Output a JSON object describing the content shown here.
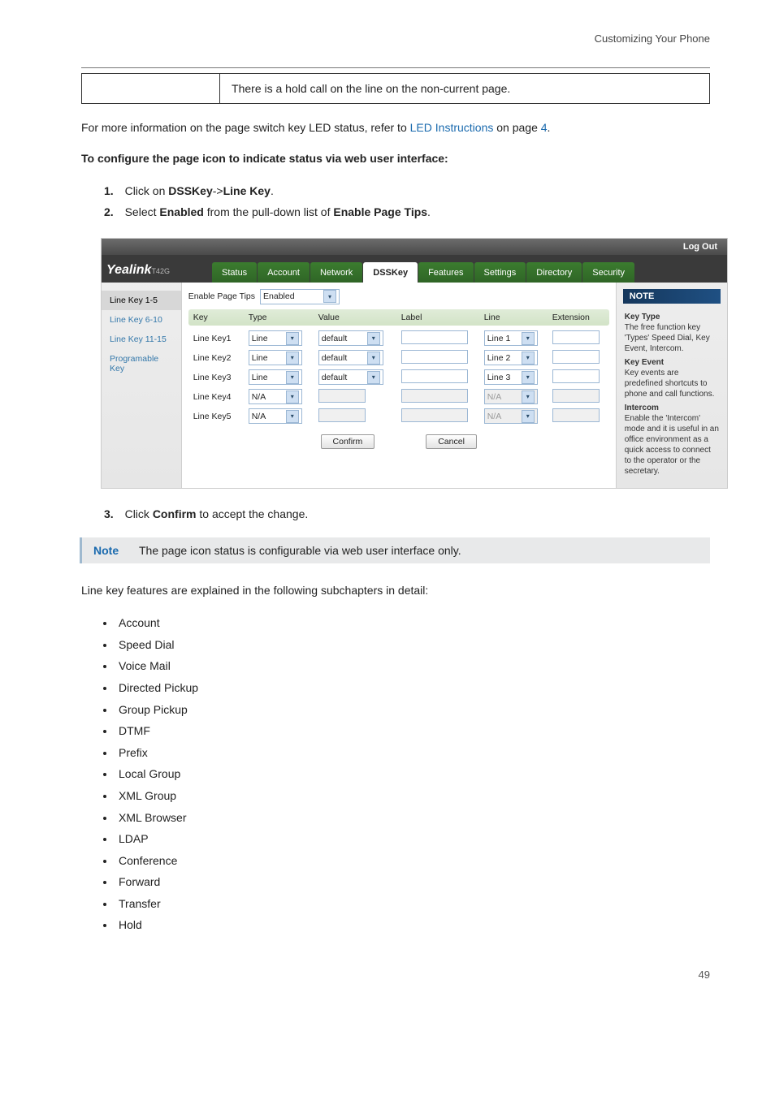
{
  "header": {
    "title": "Customizing Your Phone"
  },
  "infobox": {
    "text": "There is a hold call on the line on the non-current page."
  },
  "intro": {
    "pre": "For more information on the page switch key LED status, refer to ",
    "link": "LED Instructions",
    "post": " on page ",
    "page": "4",
    "period": "."
  },
  "subhead": "To configure the page icon to indicate status via web user interface:",
  "steps": [
    {
      "n": "1.",
      "pre": "Click on ",
      "b1": "DSSKey",
      "mid": "->",
      "b2": "Line Key",
      "post": "."
    },
    {
      "n": "2.",
      "pre": "Select ",
      "b1": "Enabled",
      "mid": " from the pull-down list of ",
      "b2": "Enable Page Tips",
      "post": "."
    }
  ],
  "step3": {
    "n": "3.",
    "pre": "Click ",
    "b1": "Confirm",
    "post": " to accept the change."
  },
  "note": {
    "label": "Note",
    "text": "The page icon status is configurable via web user interface only."
  },
  "subchapters_intro": "Line key features are explained in the following subchapters in detail:",
  "bullets": [
    "Account",
    "Speed Dial",
    "Voice Mail",
    "Directed Pickup",
    "Group Pickup",
    "DTMF",
    "Prefix",
    "Local Group",
    "XML Group",
    "XML Browser",
    "LDAP",
    "Conference",
    "Forward",
    "Transfer",
    "Hold"
  ],
  "pagenum": "49",
  "screenshot": {
    "logout": "Log Out",
    "logo": "Yealink",
    "logo_sub": "T42G",
    "tabs": [
      "Status",
      "Account",
      "Network",
      "DSSKey",
      "Features",
      "Settings",
      "Directory",
      "Security"
    ],
    "active_tab": "DSSKey",
    "side_items": [
      "Line Key 1-5",
      "Line Key 6-10",
      "Line Key 11-15",
      "Programable Key"
    ],
    "side_active": "Line Key 1-5",
    "enable_label": "Enable Page Tips",
    "enable_value": "Enabled",
    "cols": [
      "Key",
      "Type",
      "Value",
      "Label",
      "Line",
      "Extension"
    ],
    "rows": [
      {
        "key": "Line Key1",
        "type": "Line",
        "value": "default",
        "label": "",
        "line": "Line 1",
        "ext": "",
        "na": false
      },
      {
        "key": "Line Key2",
        "type": "Line",
        "value": "default",
        "label": "",
        "line": "Line 2",
        "ext": "",
        "na": false
      },
      {
        "key": "Line Key3",
        "type": "Line",
        "value": "default",
        "label": "",
        "line": "Line 3",
        "ext": "",
        "na": false
      },
      {
        "key": "Line Key4",
        "type": "N/A",
        "value": "",
        "label": "",
        "line": "N/A",
        "ext": "",
        "na": true
      },
      {
        "key": "Line Key5",
        "type": "N/A",
        "value": "",
        "label": "",
        "line": "N/A",
        "ext": "",
        "na": true
      }
    ],
    "confirm": "Confirm",
    "cancel": "Cancel",
    "note_title": "NOTE",
    "note_body": [
      {
        "h": "Key Type",
        "t": "The free function key 'Types' Speed Dial, Key Event, Intercom."
      },
      {
        "h": "Key Event",
        "t": "Key events are predefined shortcuts to phone and call functions."
      },
      {
        "h": "Intercom",
        "t": "Enable the 'Intercom' mode and it is useful in an office environment as a quick access to connect to the operator or the secretary."
      }
    ]
  }
}
